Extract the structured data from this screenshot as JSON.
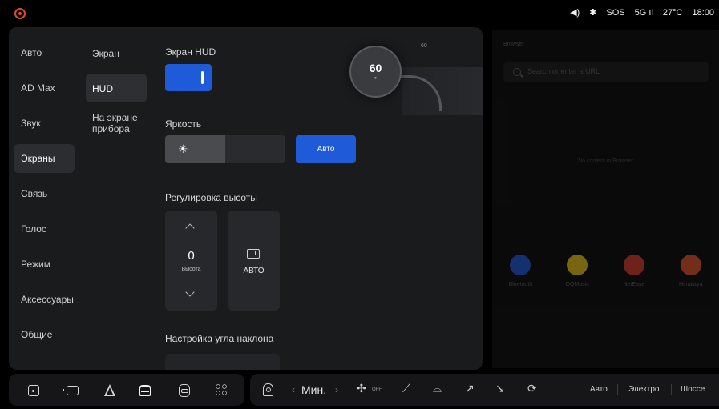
{
  "status_bar": {
    "sos": "SOS",
    "network": "5G",
    "signal": "ıl",
    "temperature": "27°C",
    "time": "18:00"
  },
  "nav_primary": {
    "items": [
      "Авто",
      "AD Max",
      "Звук",
      "Экраны",
      "Связь",
      "Голос",
      "Режим",
      "Аксессуары",
      "Общие"
    ],
    "active": "Экраны"
  },
  "nav_secondary": {
    "items": [
      "Экран",
      "HUD",
      "На экране прибора"
    ],
    "active": "HUD"
  },
  "hud": {
    "title": "Экран HUD",
    "enabled": true,
    "preview_speed": "60",
    "preview_unit": "°",
    "preview_limit": "60",
    "brightness_title": "Яркость",
    "brightness_level": 0.5,
    "brightness_auto_label": "Авто",
    "height_title": "Регулировка высоты",
    "height_value": "0",
    "height_label": "Высота",
    "height_auto_label": "АВТО",
    "tilt_title": "Настройка угла наклона"
  },
  "browser": {
    "title": "Browser",
    "search_placeholder": "Search or enter a URL",
    "empty_text": "No content in Browser",
    "apps": [
      {
        "name": "Bluetooth",
        "color": "#1f5bd9"
      },
      {
        "name": "QQMusic",
        "color": "#e8c21d"
      },
      {
        "name": "NetEase",
        "color": "#d93c2b"
      },
      {
        "name": "Himalaya",
        "color": "#e0542a"
      }
    ]
  },
  "dock": {
    "climate_mode": "Мин.",
    "fan_label": "OFF",
    "drive_modes": [
      "Авто",
      "Электро",
      "Шоссе"
    ]
  }
}
